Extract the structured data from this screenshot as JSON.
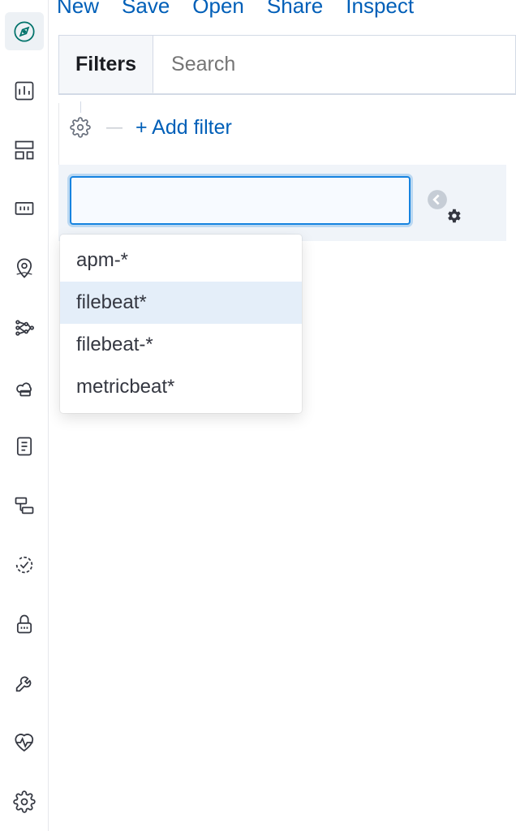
{
  "toolbar": {
    "new": "New",
    "save": "Save",
    "open": "Open",
    "share": "Share",
    "inspect": "Inspect"
  },
  "searchbar": {
    "filters_tab": "Filters",
    "search_placeholder": "Search"
  },
  "filterbar": {
    "add_filter": "+ Add filter"
  },
  "index_pattern": {
    "value": "",
    "options": [
      "apm-*",
      "filebeat*",
      "filebeat-*",
      "metricbeat*"
    ],
    "highlighted_index": 1
  },
  "sidebar": {
    "items": [
      {
        "name": "discover",
        "active": true
      },
      {
        "name": "visualize"
      },
      {
        "name": "dashboard"
      },
      {
        "name": "canvas"
      },
      {
        "name": "maps"
      },
      {
        "name": "ml"
      },
      {
        "name": "infrastructure"
      },
      {
        "name": "logs"
      },
      {
        "name": "apm"
      },
      {
        "name": "uptime"
      },
      {
        "name": "siem"
      },
      {
        "name": "dev-tools"
      },
      {
        "name": "monitoring"
      },
      {
        "name": "management"
      }
    ]
  }
}
